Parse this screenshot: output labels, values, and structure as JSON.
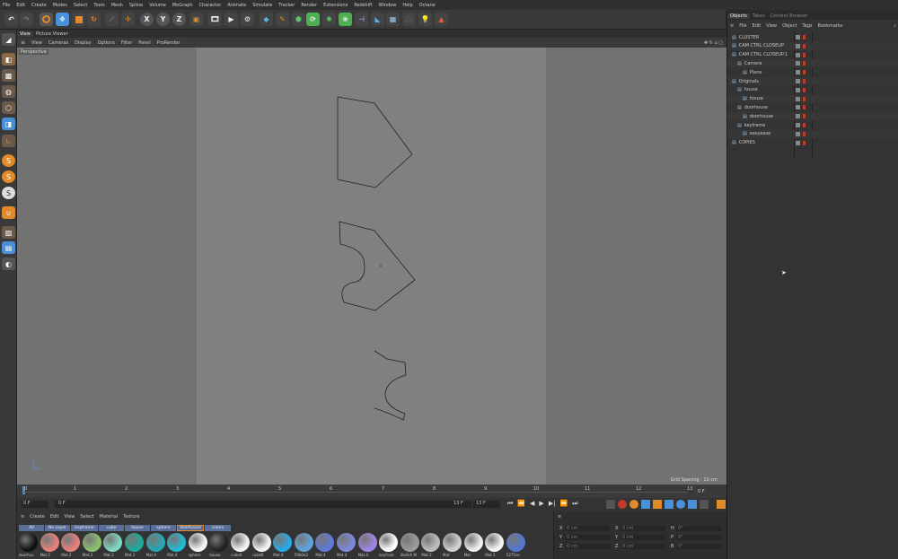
{
  "menubar": [
    "File",
    "Edit",
    "Create",
    "Modes",
    "Select",
    "Tools",
    "Mesh",
    "Spline",
    "Volume",
    "MoGraph",
    "Character",
    "Animate",
    "Simulate",
    "Tracker",
    "Render",
    "Extensions",
    "Redshift",
    "Window",
    "Help",
    "Octane"
  ],
  "toolbar": {
    "axis_x": "X",
    "axis_y": "Y",
    "axis_z": "Z"
  },
  "lefttools": {
    "s1": "S",
    "s2": "S",
    "s3": "S"
  },
  "viewport": {
    "tabs": [
      "View",
      "Picture Viewer"
    ],
    "menu": [
      "View",
      "Cameras",
      "Display",
      "Options",
      "Filter",
      "Panel",
      "ProRender"
    ],
    "camera_label": "Perspective",
    "grid_spacing": "Grid Spacing : 10 cm"
  },
  "timeline": {
    "ticks": [
      "0",
      "1",
      "2",
      "3",
      "4",
      "5",
      "6",
      "7",
      "8",
      "9",
      "10",
      "11",
      "12",
      "13"
    ],
    "end_label": "0 F"
  },
  "transport": {
    "current_frame": "0 F",
    "start_frame": "0 F",
    "end_frame_a": "13 F",
    "end_frame_b": "13 F"
  },
  "material_panel": {
    "menu": [
      "Create",
      "Edit",
      "View",
      "Select",
      "Material",
      "Texture"
    ],
    "filters": [
      "All",
      "No Layer",
      "keyframe",
      "cube",
      "house",
      "sphere",
      "doorhouse",
      "colors"
    ],
    "materials": [
      {
        "label": "doorhou",
        "color": "#111111"
      },
      {
        "label": "Mat.2",
        "color": "#e5807a"
      },
      {
        "label": "Mat.2",
        "color": "#e5807a"
      },
      {
        "label": "Mat.3",
        "color": "#8cc070"
      },
      {
        "label": "Mat.3",
        "color": "#7ed7c0"
      },
      {
        "label": "Mat.3",
        "color": "#1ea898"
      },
      {
        "label": "Mat.4",
        "color": "#24a7b5"
      },
      {
        "label": "Mat.4",
        "color": "#24b9d2"
      },
      {
        "label": "sphere",
        "color": "#f5f5f5"
      },
      {
        "label": "house",
        "color": "#222222"
      },
      {
        "label": "cubeA",
        "color": "#f2f2f2"
      },
      {
        "label": "cubeB",
        "color": "#f2f2f2"
      },
      {
        "label": "Mat.4",
        "color": "#2aa8e8"
      },
      {
        "label": "59b0e3",
        "color": "#5fa3dc"
      },
      {
        "label": "Mat.4",
        "color": "#5f78d8"
      },
      {
        "label": "Mat.4",
        "color": "#7b88dd"
      },
      {
        "label": "Mat.4",
        "color": "#a085e6"
      },
      {
        "label": "keyfram",
        "color": "#ffffff"
      },
      {
        "label": "Sketch M",
        "color": "#9a9a9a"
      },
      {
        "label": "Mat.2",
        "color": "#bdbdbd"
      },
      {
        "label": "Mat",
        "color": "#d0d0d0"
      },
      {
        "label": "Mat",
        "color": "#eeeeee"
      },
      {
        "label": "Mat.1",
        "color": "#f5f5f5"
      },
      {
        "label": "5275ce",
        "color": "#5275ce"
      }
    ]
  },
  "coords": {
    "rows": [
      {
        "a": "X",
        "av": "0 cm",
        "b": "X",
        "bv": "0 cm",
        "c": "H",
        "cv": "0°"
      },
      {
        "a": "Y",
        "av": "0 cm",
        "b": "Y",
        "bv": "0 cm",
        "c": "P",
        "cv": "0°"
      },
      {
        "a": "Z",
        "av": "0 cm",
        "b": "Z",
        "bv": "0 cm",
        "c": "B",
        "cv": "0°"
      }
    ]
  },
  "objects_panel": {
    "tabs": [
      "Objects",
      "Takes",
      "Content Browser"
    ],
    "menu": [
      "File",
      "Edit",
      "View",
      "Object",
      "Tags",
      "Bookmarks"
    ],
    "rows": [
      {
        "label": "CLUSTER",
        "indent": 0
      },
      {
        "label": "CAM CTRL CLOSEUP",
        "indent": 0
      },
      {
        "label": "CAM CTRL CLOSEUP.1",
        "indent": 0
      },
      {
        "label": "Camera",
        "indent": 1
      },
      {
        "label": "Plane",
        "indent": 2
      },
      {
        "label": "Originals",
        "indent": 0
      },
      {
        "label": "house",
        "indent": 1
      },
      {
        "label": "house",
        "indent": 2
      },
      {
        "label": "doorhouse",
        "indent": 1
      },
      {
        "label": "doorhouse",
        "indent": 2
      },
      {
        "label": "keyframe",
        "indent": 1
      },
      {
        "label": "easyease",
        "indent": 2
      },
      {
        "label": "COPIES",
        "indent": 0
      }
    ]
  },
  "colors": {
    "accent": "#4a90d9",
    "orange": "#e08a2a"
  }
}
